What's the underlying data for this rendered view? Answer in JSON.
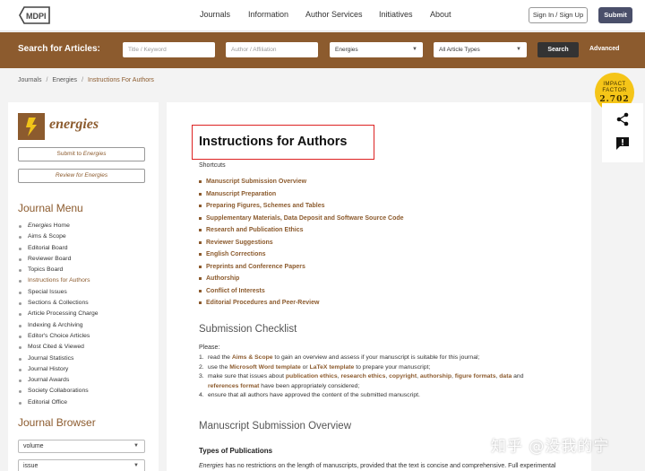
{
  "header": {
    "logo_text": "MDPI",
    "nav": [
      "Journals",
      "Information",
      "Author Services",
      "Initiatives",
      "About"
    ],
    "signin_label": "Sign In / Sign Up",
    "submit_label": "Submit"
  },
  "search": {
    "label": "Search for Articles:",
    "title_placeholder": "Title / Keyword",
    "author_placeholder": "Author / Affiliation",
    "journal_value": "Energies",
    "type_value": "All Article Types",
    "search_button": "Search",
    "advanced_label": "Advanced"
  },
  "breadcrumb": [
    "Journals",
    "Energies",
    "Instructions For Authors"
  ],
  "impact_badge": {
    "line1": "IMPACT",
    "line2": "FACTOR",
    "value": "2.702"
  },
  "sidebar": {
    "journal_name": "energies",
    "submit_button": {
      "prefix": "Submit to ",
      "journal": "Energies"
    },
    "review_button": {
      "prefix": "Review for ",
      "journal": "Energies"
    },
    "menu_heading": "Journal Menu",
    "menu_items": [
      {
        "italic": "Energies",
        "label": " Home"
      },
      {
        "label": "Aims & Scope"
      },
      {
        "label": "Editorial Board"
      },
      {
        "label": "Reviewer Board"
      },
      {
        "label": "Topics Board"
      },
      {
        "label": "Instructions for Authors",
        "active": true
      },
      {
        "label": "Special Issues"
      },
      {
        "label": "Sections & Collections"
      },
      {
        "label": "Article Processing Charge"
      },
      {
        "label": "Indexing & Archiving"
      },
      {
        "label": "Editor's Choice Articles"
      },
      {
        "label": "Most Cited & Viewed"
      },
      {
        "label": "Journal Statistics"
      },
      {
        "label": "Journal History"
      },
      {
        "label": "Journal Awards"
      },
      {
        "label": "Society Collaborations"
      },
      {
        "label": "Editorial Office"
      }
    ],
    "browser_heading": "Journal Browser",
    "volume_select": "volume",
    "issue_select": "issue"
  },
  "main": {
    "title": "Instructions for Authors",
    "shortcuts_label": "Shortcuts",
    "shortcuts": [
      "Manuscript Submission Overview",
      "Manuscript Preparation",
      "Preparing Figures, Schemes and Tables",
      "Supplementary Materials, Data Deposit and Software Source Code",
      "Research and Publication Ethics",
      "Reviewer Suggestions",
      "English Corrections",
      "Preprints and Conference Papers",
      "Authorship",
      "Conflict of Interests",
      "Editorial Procedures and Peer-Review"
    ],
    "checklist_heading": "Submission Checklist",
    "please": "Please:",
    "checklist": {
      "item1": {
        "num": "1.",
        "pre": "read the ",
        "link": "Aims & Scope",
        "post": " to gain an overview and assess if your manuscript is suitable for this journal;"
      },
      "item2": {
        "num": "2.",
        "pre": "use the ",
        "link1": "Microsoft Word template",
        "mid": " or ",
        "link2": "LaTeX template",
        "post": " to prepare your manuscript;"
      },
      "item3": {
        "num": "3.",
        "pre": "make sure that issues about ",
        "l1": "publication ethics",
        "l2": "research ethics",
        "l3": "copyright",
        "l4": "authorship",
        "l5": "figure formats",
        "l6": "data",
        "and": " and ",
        "l7": "references format",
        "post": " have been appropriately considered;"
      },
      "item4": {
        "num": "4.",
        "text": "ensure that all authors have approved the content of the submitted manuscript."
      }
    },
    "overview_heading": "Manuscript Submission Overview",
    "types_heading": "Types of Publications",
    "last_para_italic": "Energies",
    "last_para": " has no restrictions on the length of manuscripts, provided that the text is concise and comprehensive. Full experimental"
  },
  "watermark": "知乎 @没我的宁"
}
